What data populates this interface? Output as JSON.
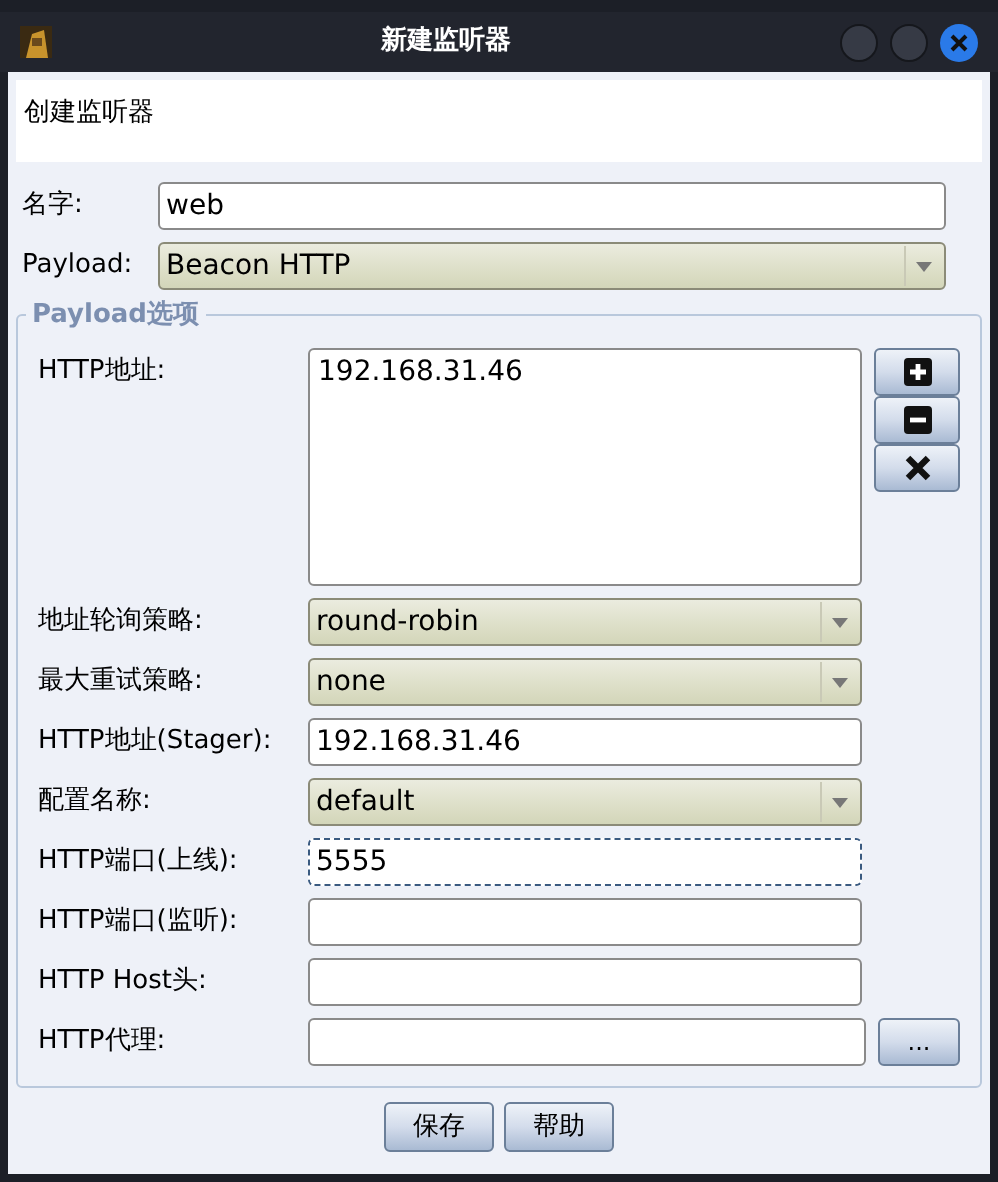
{
  "window": {
    "title": "新建监听器"
  },
  "header": {
    "text": "创建监听器"
  },
  "top_fields": [
    {
      "label": "名字:",
      "kind": "text",
      "value": "web",
      "focused": false
    },
    {
      "label": "Payload:",
      "kind": "select",
      "value": "Beacon HTTP",
      "focused": false
    }
  ],
  "group": {
    "title": "Payload选项",
    "fields": [
      {
        "label": "HTTP地址:",
        "kind": "list",
        "items": [
          "192.168.31.46"
        ],
        "buttons": [
          {
            "kind": "add"
          },
          {
            "kind": "remove"
          },
          {
            "kind": "clear"
          }
        ]
      },
      {
        "label": "地址轮询策略:",
        "kind": "select",
        "value": "round-robin",
        "focused": false
      },
      {
        "label": "最大重试策略:",
        "kind": "select",
        "value": "none",
        "focused": false
      },
      {
        "label": "HTTP地址(Stager):",
        "kind": "text",
        "value": "192.168.31.46",
        "focused": false
      },
      {
        "label": "配置名称:",
        "kind": "select",
        "value": "default",
        "focused": false
      },
      {
        "label": "HTTP端口(上线):",
        "kind": "text",
        "value": "5555",
        "focused": true
      },
      {
        "label": "HTTP端口(监听):",
        "kind": "text",
        "focused": false
      },
      {
        "label": "HTTP Host头:",
        "kind": "text",
        "focused": false
      },
      {
        "label": "HTTP代理:",
        "kind": "text",
        "focused": false,
        "button": "..."
      }
    ]
  },
  "buttons": [
    {
      "label": "保存"
    },
    {
      "label": "帮助"
    }
  ]
}
